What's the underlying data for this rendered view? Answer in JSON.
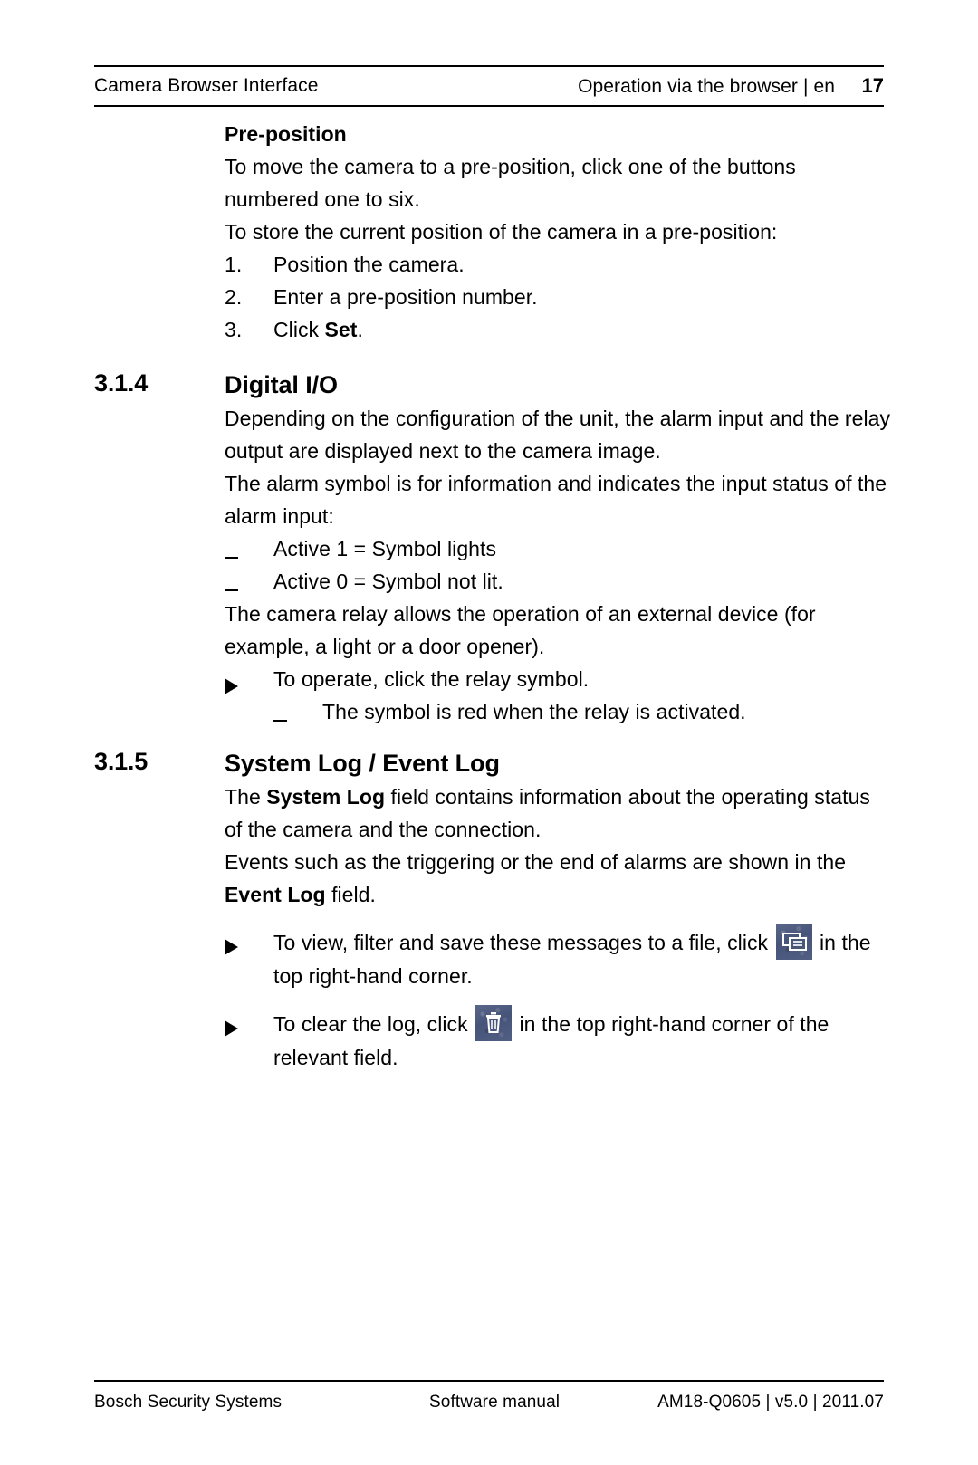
{
  "header": {
    "left_title": "Camera Browser Interface",
    "right_title": "Operation via the browser | en",
    "page_number": "17"
  },
  "body": {
    "preposition": {
      "heading": "Pre-position",
      "para1": "To move the camera to a pre-position, click one of the buttons numbered one to six.",
      "para2": "To store the current position of the camera in a pre-position:",
      "steps": [
        {
          "marker": "1.",
          "text": "Position the camera."
        },
        {
          "marker": "2.",
          "text": "Enter a pre-position number."
        },
        {
          "marker": "3.",
          "text_before": "Click ",
          "bold": "Set",
          "text_after": "."
        }
      ]
    },
    "section_314": {
      "number": "3.1.4",
      "title": "Digital I/O",
      "para1": "Depending on the configuration of the unit, the alarm input and the relay output are displayed next to the camera image.",
      "para2": "The alarm symbol is for information and indicates the input status of the alarm input:",
      "dashes": [
        "Active 1 = Symbol lights",
        "Active 0 = Symbol not lit."
      ],
      "para3": "The camera relay allows the operation of an external device (for example, a light or a door opener).",
      "action": "To operate, click the relay symbol.",
      "subdash": "The symbol is red when the relay is activated."
    },
    "section_315": {
      "number": "3.1.5",
      "title": "System Log / Event Log",
      "para1_a": "The ",
      "para1_bold": "System Log",
      "para1_b": " field contains information about the operating status of the camera and the connection.",
      "para2_a": "Events such as the triggering or the end of alarms are shown in the ",
      "para2_bold": "Event Log",
      "para2_b": " field.",
      "action1_a": "To view, filter and save these messages to a file, click ",
      "action1_icon": "window-log-icon",
      "action1_b": " in the top right-hand corner.",
      "action2_a": "To clear the log, click ",
      "action2_icon": "trash-icon",
      "action2_b": " in the top right-hand corner of the relevant field."
    }
  },
  "footer": {
    "left": "Bosch Security Systems",
    "middle": "Software manual",
    "right": "AM18-Q0605 | v5.0 | 2011.07"
  },
  "colors": {
    "icon_background": "#4a5878",
    "text": "#000000",
    "page_background": "#ffffff"
  }
}
